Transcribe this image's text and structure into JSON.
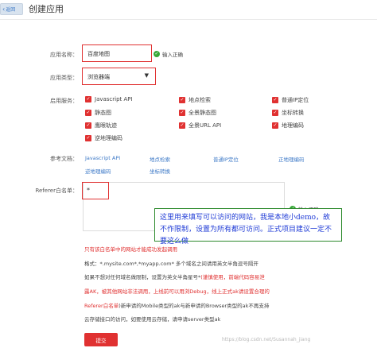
{
  "header": {
    "back_label": "返回",
    "title": "创建应用"
  },
  "form": {
    "app_name": {
      "label": "应用名称：",
      "value": "百度地图",
      "valid_text": "输入正确"
    },
    "app_type": {
      "label": "应用类型：",
      "value": "浏览器端"
    },
    "services": {
      "label": "启用服务：",
      "items": [
        "Javascript API",
        "地点检索",
        "普通IP定位",
        "静态图",
        "全景静态图",
        "坐标转换",
        "鹰眼轨迹",
        "全景URL API",
        "地理编码",
        "逆地理编码"
      ]
    },
    "docs": {
      "label": "参考文档：",
      "links": [
        "Javascript API",
        "地点检索",
        "普通IP定位",
        "正地理编码",
        "逆地理编码",
        "坐标转换"
      ]
    },
    "referer": {
      "label": "Referer白名单：",
      "value": "*",
      "valid_text": "输入正确"
    }
  },
  "annotation": "这里用来填写可以访问的网站，我是本地小demo，故不作限制，设置为所有都可访问。正式项目建议一定不要这么做",
  "notes": {
    "line1": "只有该白名单中的网站才能成功发起调用",
    "line2": "格式：*.mysite.com*,*myapp.com* 多个域名之间请用英文半角逗号隔开",
    "line3a": "如果不想对任何域名做限制，设置为英文半角星号*",
    "line3b": "(谨慎使用，前端代码容易泄",
    "line4": "露AK，被其他网站非法调用，上线前可以用浏Debug，线上正式ak请设置合理的",
    "line5a": "Referer白名单",
    "line5b": ")新申请的Mobile类型的ak与新申请的Browser类型的ak不再支持",
    "line6": "云存储接口的访问，如要使用云存储，请申请server类型ak"
  },
  "submit_label": "提交",
  "watermark": "https://blog.csdn.net/Susannah_jiang",
  "colors": {
    "accent_red": "#e03131",
    "link_blue": "#3d79c7",
    "valid_green": "#38a838",
    "annotation_border": "#2d8a2d",
    "annotation_text": "#1f3bd6"
  },
  "icons": {
    "back": "chevron-left-icon",
    "dropdown": "triangle-down-icon",
    "valid": "check-circle-icon",
    "checkbox": "checked-box-icon"
  }
}
